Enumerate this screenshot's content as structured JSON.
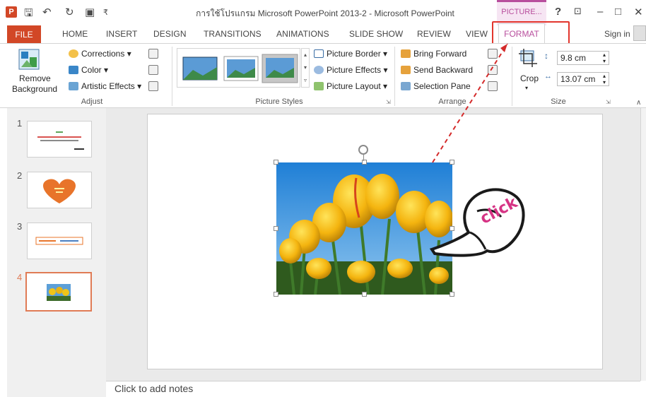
{
  "window": {
    "title": "การใช้โปรแกรม Microsoft PowerPoint 2013-2 - Microsoft PowerPoint",
    "context_tab": "PICTURE...",
    "help": "?",
    "minimize": "–",
    "maximize": "□",
    "close": "✕"
  },
  "qat": {
    "save": "🖫",
    "undo": "↶",
    "redo": "↻",
    "slideshow": "▣",
    "customize": "₹"
  },
  "tabs": {
    "file": "FILE",
    "home": "HOME",
    "insert": "INSERT",
    "design": "DESIGN",
    "transitions": "TRANSITIONS",
    "animations": "ANIMATIONS",
    "slideshow": "SLIDE SHOW",
    "review": "REVIEW",
    "view": "VIEW",
    "format": "FORMAT",
    "sign_in": "Sign in"
  },
  "ribbon": {
    "adjust": {
      "remove_bg_line1": "Remove",
      "remove_bg_line2": "Background",
      "corrections": "Corrections ▾",
      "color": "Color ▾",
      "artistic": "Artistic Effects ▾",
      "label": "Adjust"
    },
    "picture_styles": {
      "border": "Picture Border ▾",
      "effects": "Picture Effects ▾",
      "layout": "Picture Layout ▾",
      "label": "Picture Styles"
    },
    "arrange": {
      "bring_forward": "Bring Forward",
      "send_backward": "Send Backward",
      "selection_pane": "Selection Pane",
      "label": "Arrange"
    },
    "size": {
      "crop": "Crop",
      "height": "9.8 cm",
      "width": "13.07 cm",
      "label": "Size"
    }
  },
  "slides": [
    {
      "number": "1"
    },
    {
      "number": "2"
    },
    {
      "number": "3"
    },
    {
      "number": "4"
    }
  ],
  "notes_placeholder": "Click to add notes",
  "annotation": {
    "click": "click"
  },
  "colors": {
    "accent": "#d24726",
    "context": "#b84e9d",
    "highlight": "#e2362d"
  }
}
